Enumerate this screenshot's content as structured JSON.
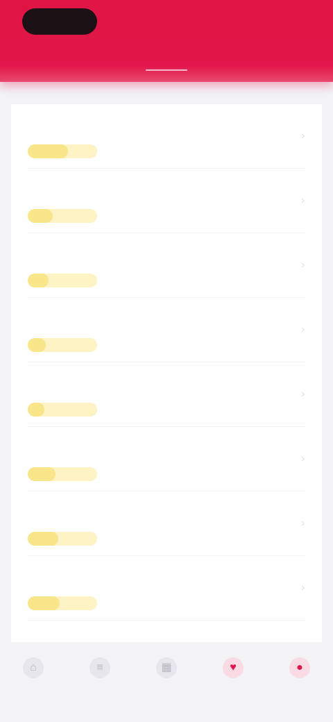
{
  "header": {
    "logo": "",
    "action": "",
    "tab": ""
  },
  "list": [
    {
      "title": "",
      "meta": "",
      "badge_level": 0.58
    },
    {
      "title": "",
      "meta": "",
      "badge_level": 0.36
    },
    {
      "title": "",
      "meta": "",
      "badge_level": 0.3
    },
    {
      "title": "",
      "meta": "",
      "badge_level": 0.26
    },
    {
      "title": "",
      "meta": "",
      "badge_level": 0.24
    },
    {
      "title": "",
      "meta": "",
      "badge_level": 0.4
    },
    {
      "title": "",
      "meta": "",
      "badge_level": 0.44
    },
    {
      "title": "",
      "meta": "",
      "badge_level": 0.46
    }
  ],
  "bottom_nav": [
    {
      "label": "",
      "icon": "home-icon",
      "glyph": "⌂",
      "active": false
    },
    {
      "label": "",
      "icon": "list-icon",
      "glyph": "≡",
      "active": false
    },
    {
      "label": "",
      "icon": "grid-icon",
      "glyph": "▦",
      "active": false
    },
    {
      "label": "",
      "icon": "heart-icon",
      "glyph": "♥",
      "active": true
    },
    {
      "label": "",
      "icon": "user-icon",
      "glyph": "●",
      "active": true
    }
  ],
  "colors": {
    "brand_red": "#e0164a",
    "badge_yellow": "#f9e58a"
  }
}
